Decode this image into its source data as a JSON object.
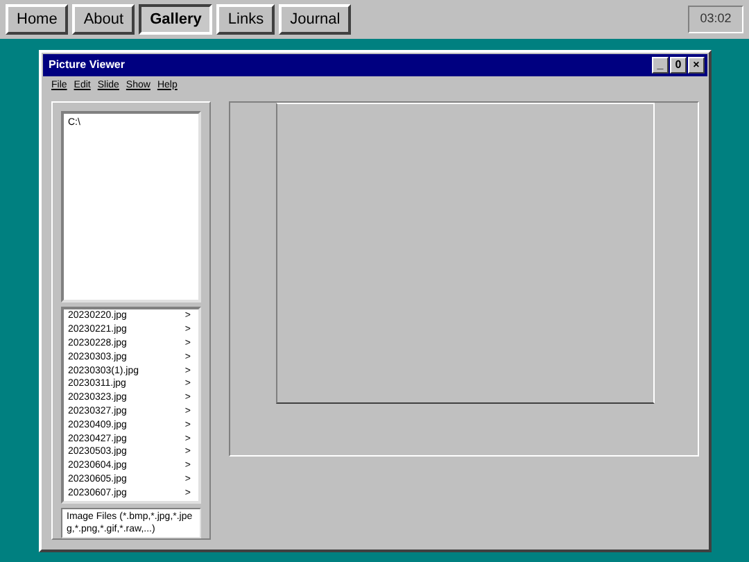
{
  "nav_tabs": [
    {
      "label": "Home",
      "selected": false
    },
    {
      "label": "About",
      "selected": false
    },
    {
      "label": "Gallery",
      "selected": true
    },
    {
      "label": "Links",
      "selected": false
    },
    {
      "label": "Journal",
      "selected": false
    }
  ],
  "clock": "03:02",
  "window": {
    "title": "Picture Viewer",
    "controls": [
      "_",
      "0",
      "×"
    ]
  },
  "menu": [
    "File",
    "Edit",
    "Slide",
    "Show",
    "Help"
  ],
  "directory_list": [
    "C:\\"
  ],
  "file_list": [
    {
      "name": "20230220.jpg",
      "arrow": ">"
    },
    {
      "name": "20230221.jpg",
      "arrow": ">"
    },
    {
      "name": "20230228.jpg",
      "arrow": ">"
    },
    {
      "name": "20230303.jpg",
      "arrow": ">"
    },
    {
      "name": "20230303(1).jpg",
      "arrow": ">"
    },
    {
      "name": "20230311.jpg",
      "arrow": ">"
    },
    {
      "name": "20230323.jpg",
      "arrow": ">"
    },
    {
      "name": "20230327.jpg",
      "arrow": ">"
    },
    {
      "name": "20230409.jpg",
      "arrow": ">"
    },
    {
      "name": "20230427.jpg",
      "arrow": ">"
    },
    {
      "name": "20230503.jpg",
      "arrow": ">"
    },
    {
      "name": "20230604.jpg",
      "arrow": ">"
    },
    {
      "name": "20230605.jpg",
      "arrow": ">"
    },
    {
      "name": "20230607.jpg",
      "arrow": ">"
    }
  ],
  "file_filter": "Image Files (*.bmp,*.jpg,*.jpeg,*.png,*.gif,*.raw,...)"
}
